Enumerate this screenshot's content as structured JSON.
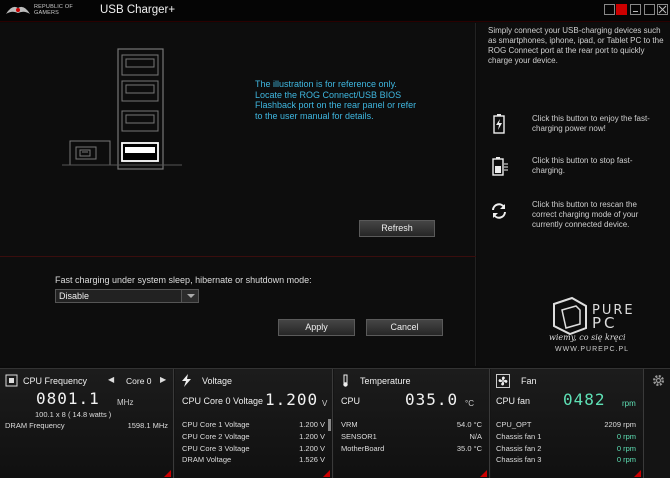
{
  "titlebar": {
    "brand_line1": "REPUBLIC OF",
    "brand_line2": "GAMERS",
    "title": "USB Charger+"
  },
  "main": {
    "reference_text": "The illustration is for reference only. Locate the ROG Connect/USB BIOS Flashback port on the rear panel or refer to the user manual for details.",
    "refresh_label": "Refresh",
    "fast_charging_label": "Fast charging under system sleep, hibernate or shutdown mode:",
    "mode_select_value": "Disable",
    "apply_label": "Apply",
    "cancel_label": "Cancel"
  },
  "help": {
    "intro": "Simply connect your USB-charging devices such as smartphones, iphone, ipad, or Tablet PC to the ROG Connect port at the rear port to quickly charge your device.",
    "items": [
      {
        "icon": "battery-charge-icon",
        "text": "Click this button to enjoy the fast-charging power now!"
      },
      {
        "icon": "stop-charging-icon",
        "text": "Click this button to stop fast-charging."
      },
      {
        "icon": "rescan-icon",
        "text": "Click this button to rescan the correct charging mode of your currently connected device."
      }
    ]
  },
  "watermark": {
    "brand_top": "PURE",
    "brand_bottom": "PC",
    "tagline": "wiemy, co się kręci",
    "url": "WWW.PUREPC.PL"
  },
  "monitor": {
    "cpu": {
      "title": "CPU Frequency",
      "core_select": "Core 0",
      "freq": "0801.1",
      "freq_unit": "MHz",
      "multiplier_line": "100.1  x  8   ( 14.8   watts )",
      "dram_label": "DRAM Frequency",
      "dram_value": "1598.1  MHz"
    },
    "voltage": {
      "title": "Voltage",
      "main_label": "CPU Core 0 Voltage",
      "main_value": "1.200",
      "main_unit": "V",
      "rows": [
        {
          "label": "CPU Core 1 Voltage",
          "value": "1.200  V"
        },
        {
          "label": "CPU Core 2 Voltage",
          "value": "1.200  V"
        },
        {
          "label": "CPU Core 3 Voltage",
          "value": "1.200  V"
        },
        {
          "label": "DRAM Voltage",
          "value": "1.526  V"
        }
      ]
    },
    "temperature": {
      "title": "Temperature",
      "main_label": "CPU",
      "main_value": "035.0",
      "main_unit": "°C",
      "rows": [
        {
          "label": "VRM",
          "value": "54.0 °C"
        },
        {
          "label": "SENSOR1",
          "value": "N/A"
        },
        {
          "label": "MotherBoard",
          "value": "35.0 °C"
        }
      ]
    },
    "fan": {
      "title": "Fan",
      "main_label": "CPU fan",
      "main_value": "0482",
      "main_unit": "rpm",
      "rows": [
        {
          "label": "CPU_OPT",
          "value": "2209  rpm"
        },
        {
          "label": "Chassis fan 1",
          "value": "0  rpm"
        },
        {
          "label": "Chassis fan 2",
          "value": "0  rpm"
        },
        {
          "label": "Chassis fan 3",
          "value": "0  rpm"
        }
      ]
    }
  },
  "colors": {
    "accent_red": "#cc0000",
    "info_blue": "#3fb7e0",
    "fan_green": "#5ee0b5"
  }
}
